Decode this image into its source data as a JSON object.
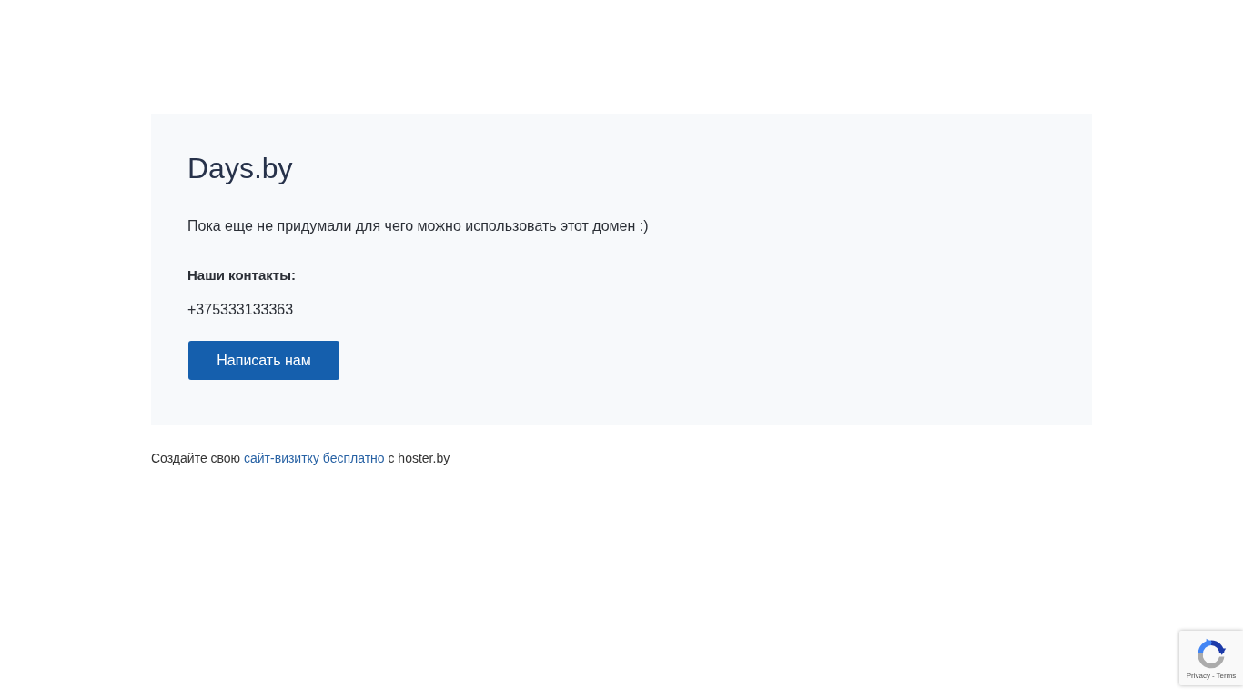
{
  "card": {
    "title": "Days.by",
    "description": "Пока еще не придумали для чего можно использовать этот домен :)",
    "contacts_heading": "Наши контакты:",
    "phone": "+375333133363",
    "button": "Написать нам"
  },
  "footer": {
    "prefix": "Создайте свою",
    "link": "сайт-визитку бесплатно",
    "suffix": "с hoster.by"
  },
  "recaptcha": {
    "privacy": "Privacy",
    "separator": "-",
    "terms": "Terms"
  }
}
